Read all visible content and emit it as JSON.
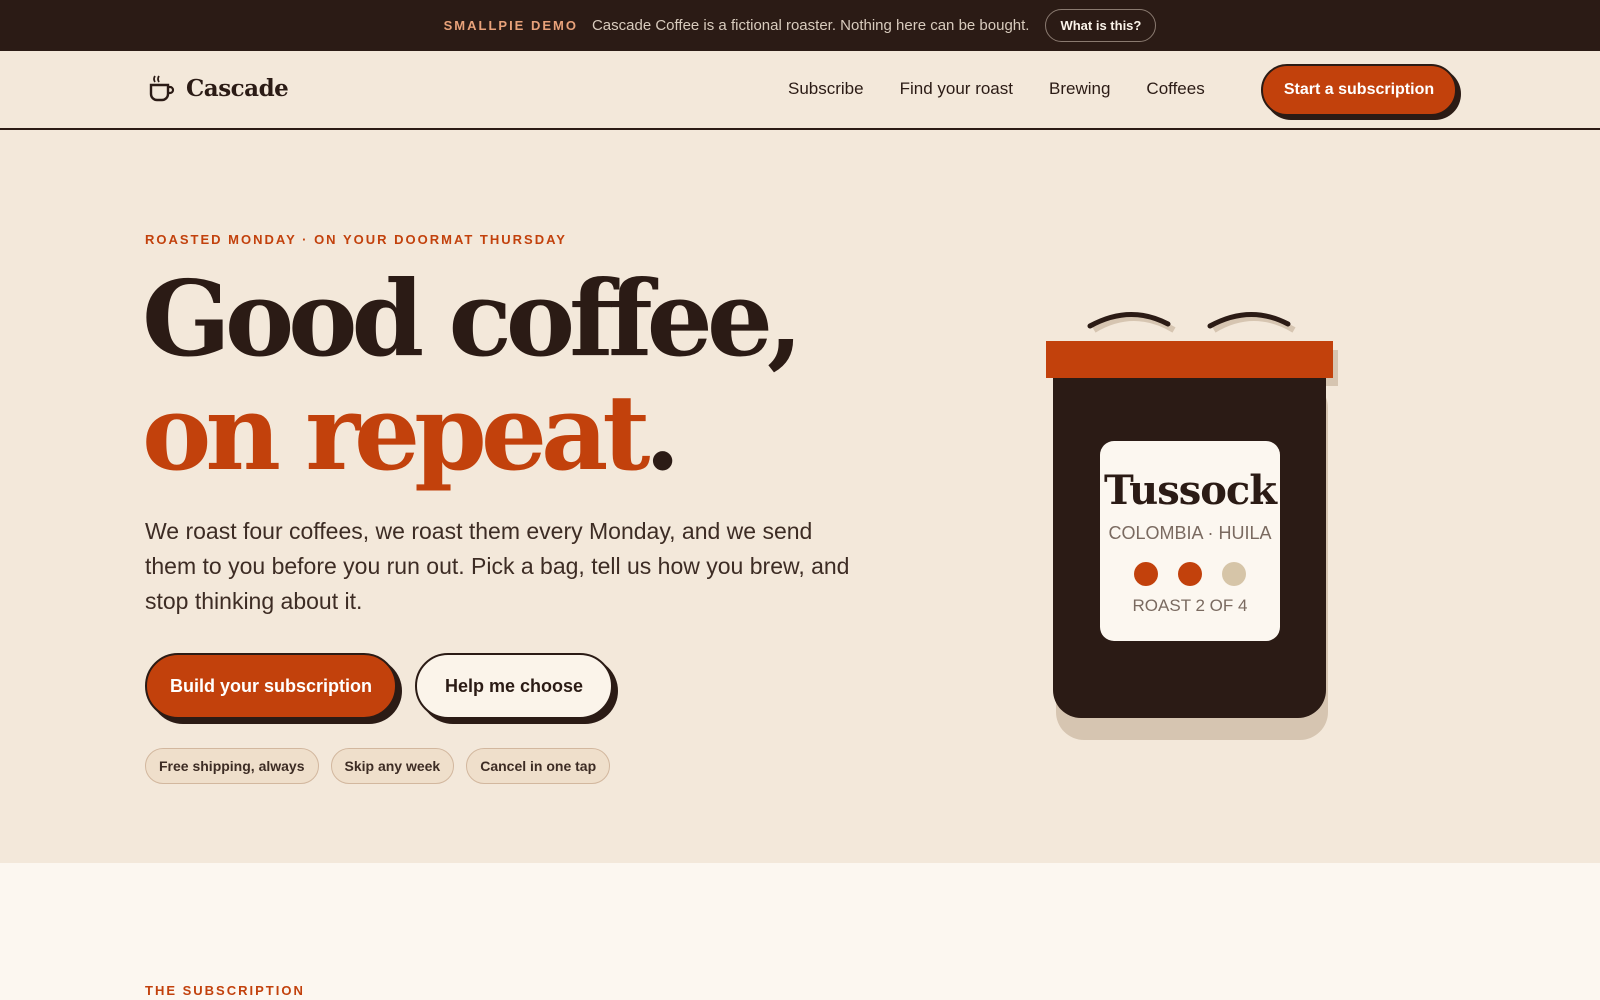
{
  "banner": {
    "tag": "SMALLPIE DEMO",
    "message": "Cascade Coffee is a fictional roaster. Nothing here can be bought.",
    "button": "What is this?"
  },
  "nav": {
    "brand": "Cascade",
    "logo_icon": "coffee-cup-icon",
    "links": [
      "Subscribe",
      "Find your roast",
      "Brewing",
      "Coffees"
    ],
    "cta": "Start a subscription"
  },
  "hero": {
    "eyebrow": "ROASTED MONDAY · ON YOUR DOORMAT THURSDAY",
    "headline_part1": "Good coffee, ",
    "headline_part2": "on repeat",
    "headline_end": ".",
    "lede": "We roast four coffees, we roast them every Monday, and we send them to you before you run out. Pick a bag, tell us how you brew, and stop thinking about it.",
    "primary_button": "Build your subscription",
    "secondary_button": "Help me choose",
    "chips": [
      "Free shipping, always",
      "Skip any week",
      "Cancel in one tap"
    ]
  },
  "bag": {
    "name": "Tussock",
    "origin": "COLOMBIA · HUILA",
    "roast_label": "ROAST 2 OF 4",
    "roast_level": 2,
    "roast_max": 3
  },
  "lower": {
    "section_label": "THE SUBSCRIPTION"
  },
  "colors": {
    "accent": "#c2410c",
    "dark": "#2b1b15",
    "cream": "#f3e8da",
    "paper": "#fcf7f0"
  }
}
